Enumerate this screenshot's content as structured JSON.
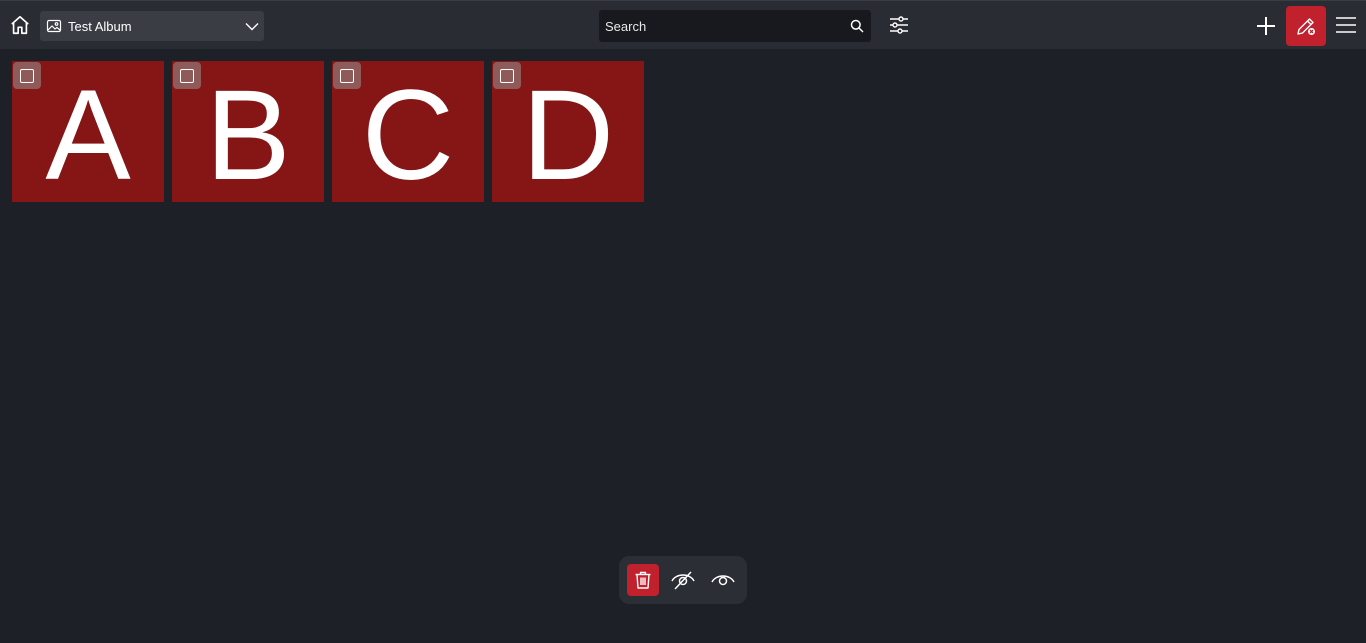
{
  "header": {
    "home_icon": "home-icon",
    "album": {
      "icon": "image-icon",
      "selected": "Test Album"
    },
    "search": {
      "placeholder": "Search",
      "value": ""
    },
    "filter_icon": "sliders-icon",
    "add_icon": "plus-icon",
    "edit_icon": "pen-cancel-icon",
    "menu_icon": "hamburger-menu-icon"
  },
  "tiles": [
    {
      "letter": "A",
      "selected": false
    },
    {
      "letter": "B",
      "selected": false
    },
    {
      "letter": "C",
      "selected": false
    },
    {
      "letter": "D",
      "selected": false
    }
  ],
  "action_bar": {
    "delete_icon": "trash-icon",
    "hide_icon": "eye-off-icon",
    "show_icon": "eye-icon"
  },
  "colors": {
    "background": "#1e2028",
    "topbar": "#2a2c33",
    "tile": "#861515",
    "accent": "#c1202d"
  }
}
